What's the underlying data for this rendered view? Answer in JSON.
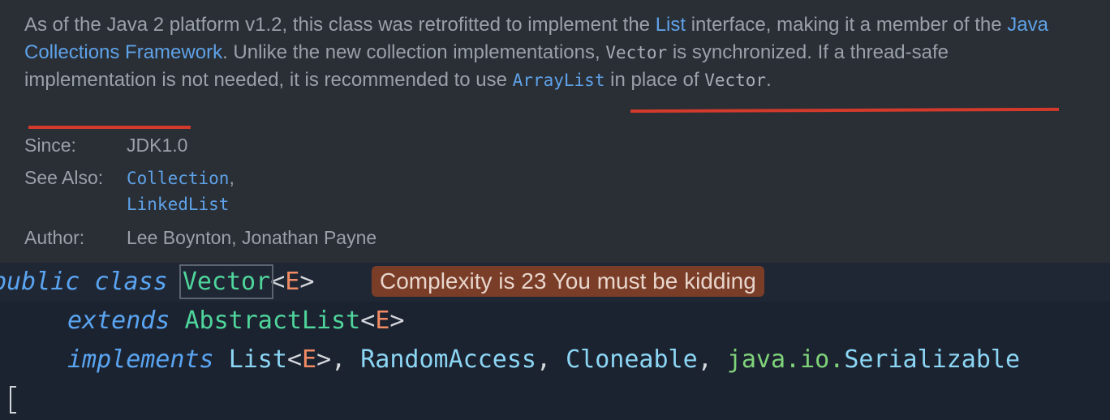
{
  "doc": {
    "p1": "As of the Java 2 platform v1.2, this class was retrofitted to implement the ",
    "p1_link": "List",
    "p2": " interface, making it a member of the ",
    "p2_link": "Java Collections Framework",
    "p3": ". Unlike the new collection implementations, ",
    "p3_code": "Vector",
    "p4": " is synchronized. If a thread-safe implementation is not needed, it is recommended to use ",
    "p4_link": "ArrayList",
    "p5": " in place of ",
    "p5_code": "Vector",
    "p6": ".",
    "since_label": "Since:",
    "since_value": "JDK1.0",
    "seealso_label": "See Also:",
    "seealso_1": "Collection",
    "seealso_1_sep": ",",
    "seealso_2": "LinkedList",
    "author_label": "Author:",
    "author_value": "Lee Boynton, Jonathan Payne",
    "underline_color": "#d23a2c"
  },
  "code": {
    "l1_kw": "public class ",
    "l1_cls": "Vector",
    "l1_gen_open": "<",
    "l1_gen": "E",
    "l1_gen_close": ">",
    "hint": "Complexity is 23 You must be kidding",
    "l2_kw": "extends ",
    "l2_cls": "AbstractList",
    "l2_gen_open": "<",
    "l2_gen": "E",
    "l2_gen_close": ">",
    "l3_kw": "implements ",
    "l3_i1": "List",
    "l3_gen_open": "<",
    "l3_gen": "E",
    "l3_gen_close": ">",
    "l3_sep1": ", ",
    "l3_i2": "RandomAccess",
    "l3_sep2": ", ",
    "l3_i3": "Cloneable",
    "l3_sep3": ", ",
    "l3_pkg": "java.io.",
    "l3_i4": "Serializable",
    "hint_color": "#7a3d28"
  }
}
